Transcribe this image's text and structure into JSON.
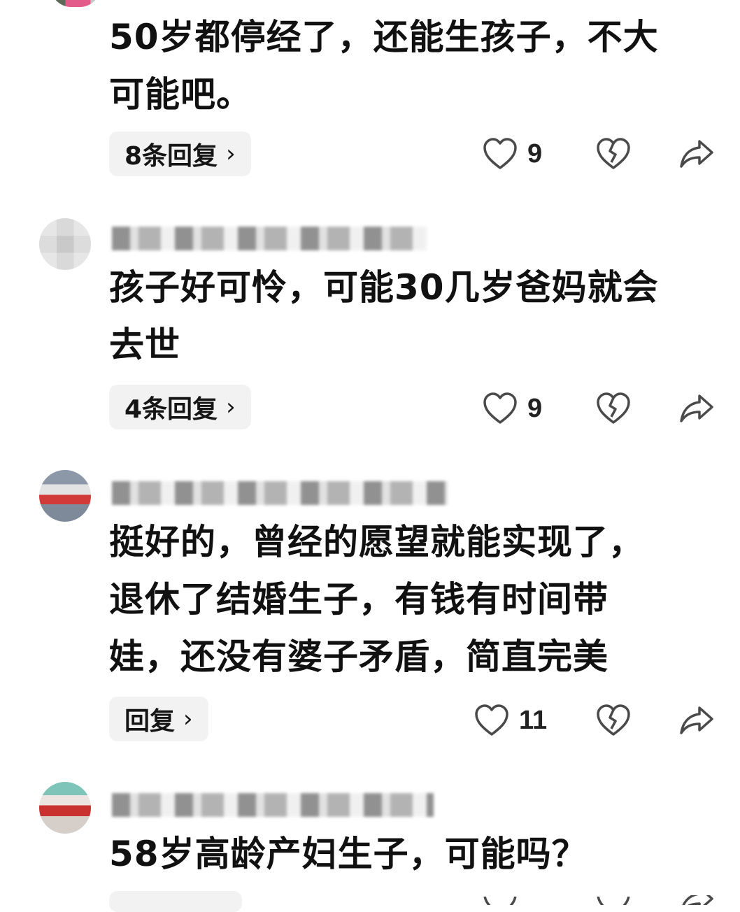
{
  "comments": [
    {
      "text": "50岁都停经了，还能生孩子，不大\n可能吧。",
      "reply_label": "8条回复",
      "likes": "9"
    },
    {
      "text": "孩子好可怜，可能30几岁爸妈就会\n去世",
      "reply_label": "4条回复",
      "likes": "9"
    },
    {
      "text": "挺好的，曾经的愿望就能实现了，\n退休了结婚生子，有钱有时间带\n娃，还没有婆子矛盾，简直完美",
      "reply_label": "回复",
      "likes": "11"
    },
    {
      "text": "58岁高龄产妇生子，可能吗？",
      "reply_label": "",
      "likes": ""
    }
  ],
  "icons": {
    "like": "heart-outline-icon",
    "dislike": "broken-heart-icon",
    "share": "share-arrow-icon",
    "reply_chevron": "chevron-right-icon"
  },
  "colors": {
    "background": "#ffffff",
    "text": "#111111",
    "pill": "#f2f2f2",
    "icon": "#4a4a4a"
  }
}
